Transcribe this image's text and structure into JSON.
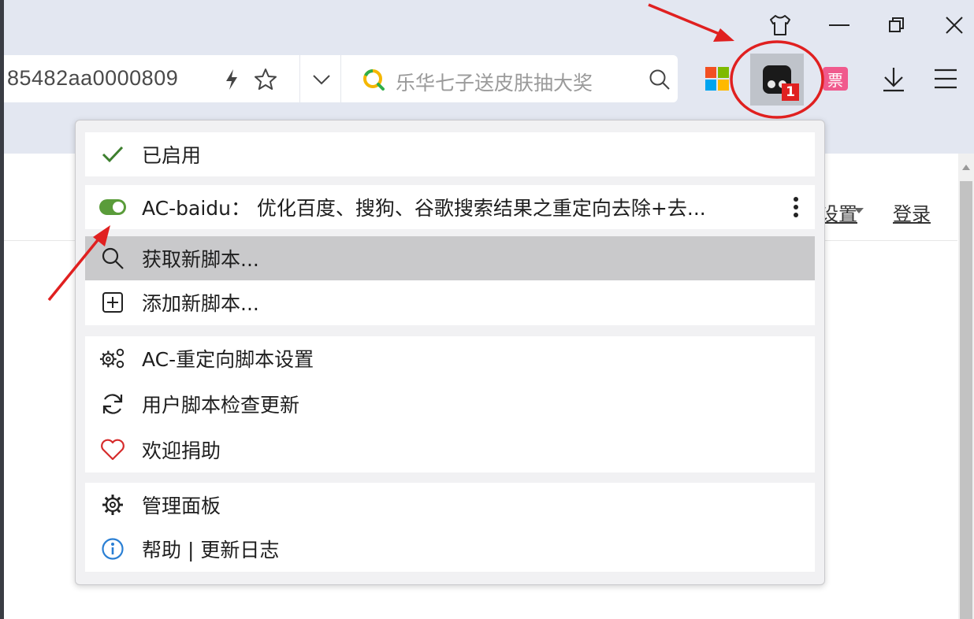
{
  "address_bar": {
    "url_fragment": "85482aa0000809",
    "search_placeholder": "乐华七子送皮肤抽大奖"
  },
  "toolbar": {
    "extension_badge": "1",
    "ticket_label": "票"
  },
  "page": {
    "settings_link": "设置",
    "login_link": "登录"
  },
  "menu": {
    "enabled_label": "已启用",
    "script_label": "AC-baidu： 优化百度、搜狗、谷歌搜索结果之重定向去除+去...",
    "get_new_script": "获取新脚本...",
    "add_new_script": "添加新脚本...",
    "ac_settings": "AC-重定向脚本设置",
    "check_updates": "用户脚本检查更新",
    "donate": "欢迎捐助",
    "dashboard": "管理面板",
    "help": "帮助 | 更新日志"
  },
  "colors": {
    "annotation_red": "#e02020",
    "toggle_green": "#5a9c3a",
    "heart_red": "#d62b2b",
    "info_blue": "#2a7fd4"
  }
}
